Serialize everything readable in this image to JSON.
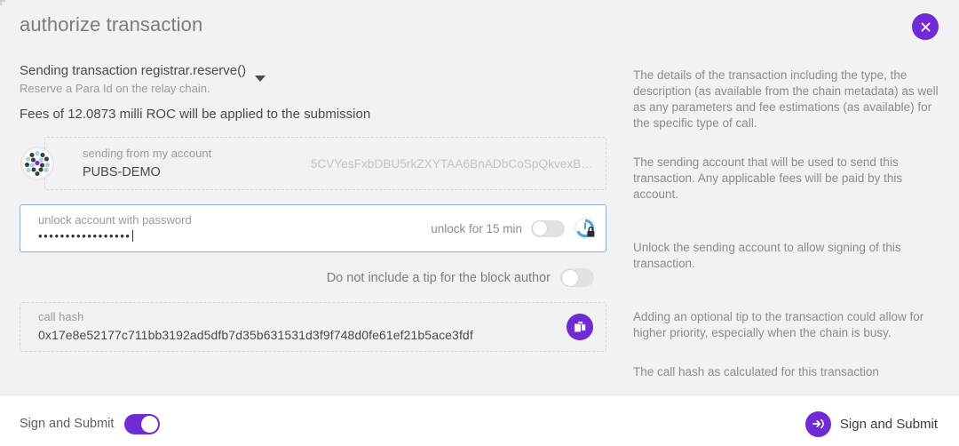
{
  "header": {
    "title": "authorize transaction",
    "close_icon": "close-icon"
  },
  "transaction": {
    "summary": "Sending transaction registrar.reserve()",
    "description": "Reserve a Para Id on the relay chain.",
    "fees": "Fees of 12.0873 milli ROC will be applied to the submission",
    "expand_icon": "chevron-down-icon"
  },
  "account": {
    "label": "sending from my account",
    "name": "PUBS-DEMO",
    "address": "5CVYesFxbDBU5rkZXYTAA6BnADbCoSpQkvexB…",
    "avatar_icon": "identicon-avatar"
  },
  "password": {
    "label": "unlock account with password",
    "value": "•••••••••••••••••",
    "placeholder": "unlock account with password",
    "unlock_label": "unlock for 15 min",
    "unlock_toggle_state": "off",
    "lock_icon": "timer-lock-icon"
  },
  "tip": {
    "label": "Do not include a tip for the block author",
    "toggle_state": "off"
  },
  "call_hash": {
    "label": "call hash",
    "value": "0x17e8e52177c711bb3192ad5dfb7d35b631531d3f9f748d0fe61ef21b5ace3fdf",
    "copy_icon": "copy-icon"
  },
  "help": {
    "transaction": "The details of the transaction including the type, the description (as available from the chain metadata) as well as any parameters and fee estimations (as available) for the specific type of call.",
    "account": "The sending account that will be used to send this transaction. Any applicable fees will be paid by this account.",
    "unlock": "Unlock the sending account to allow signing of this transaction.",
    "tip": "Adding an optional tip to the transaction could allow for higher priority, especially when the chain is busy.",
    "call_hash": "The call hash as calculated for this transaction"
  },
  "footer": {
    "toggle_label": "Sign and Submit",
    "toggle_state": "on",
    "submit_label": "Sign and Submit",
    "submit_icon": "sign-in-arrow-icon"
  },
  "colors": {
    "accent": "#6f2cd6",
    "background": "#f2f2f2",
    "footer_background": "#ffffff",
    "focus_border": "#8ab4d8",
    "muted_text": "#8c8c8c"
  }
}
